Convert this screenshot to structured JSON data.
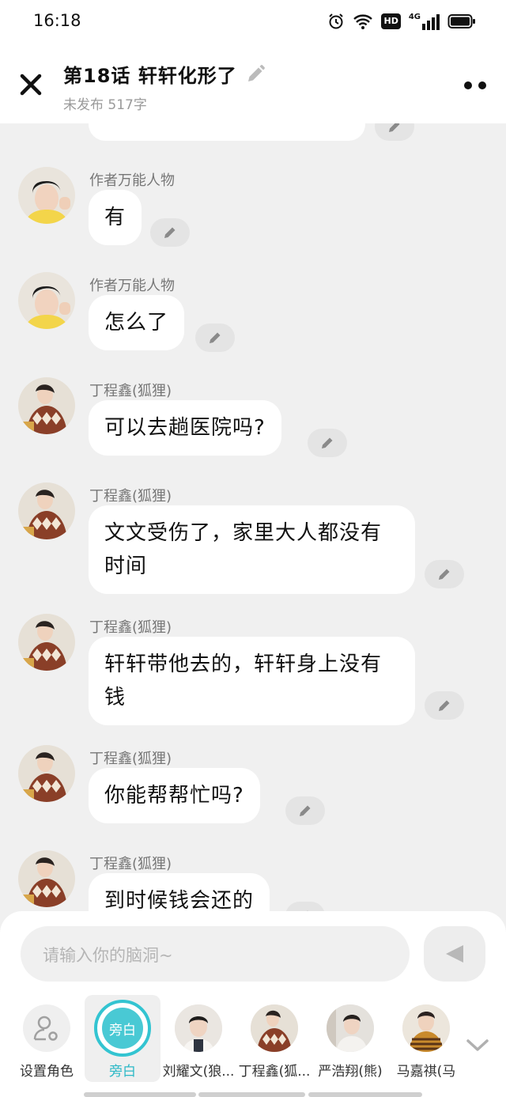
{
  "status_bar": {
    "time": "16:18",
    "hd_label": "HD",
    "network_label": "4G"
  },
  "header": {
    "title": "第18话   轩轩化形了",
    "subtitle": "未发布 517字"
  },
  "messages": [
    {
      "sender": "作者万能人物",
      "text": "有"
    },
    {
      "sender": "作者万能人物",
      "text": "怎么了"
    },
    {
      "sender": "丁程鑫(狐狸)",
      "text": "可以去趟医院吗?"
    },
    {
      "sender": "丁程鑫(狐狸)",
      "line1": "文文受伤了，家里大人都没有",
      "line2": "时间"
    },
    {
      "sender": "丁程鑫(狐狸)",
      "line1": "轩轩带他去的，轩轩身上没有",
      "line2": "钱"
    },
    {
      "sender": "丁程鑫(狐狸)",
      "text": "你能帮帮忙吗?"
    },
    {
      "sender": "丁程鑫(狐狸)",
      "text": "到时候钱会还的"
    }
  ],
  "input": {
    "placeholder": "请输入你的脑洞~"
  },
  "roles": [
    {
      "label": "设置角色"
    },
    {
      "label": "旁白",
      "badge": "旁白"
    },
    {
      "label": "刘耀文(狼..."
    },
    {
      "label": "丁程鑫(狐..."
    },
    {
      "label": "严浩翔(熊)"
    },
    {
      "label": "马嘉祺(马"
    }
  ],
  "colors": {
    "accent": "#33c4d1",
    "bubble": "#ffffff",
    "chat_bg": "#f0f0f0"
  }
}
